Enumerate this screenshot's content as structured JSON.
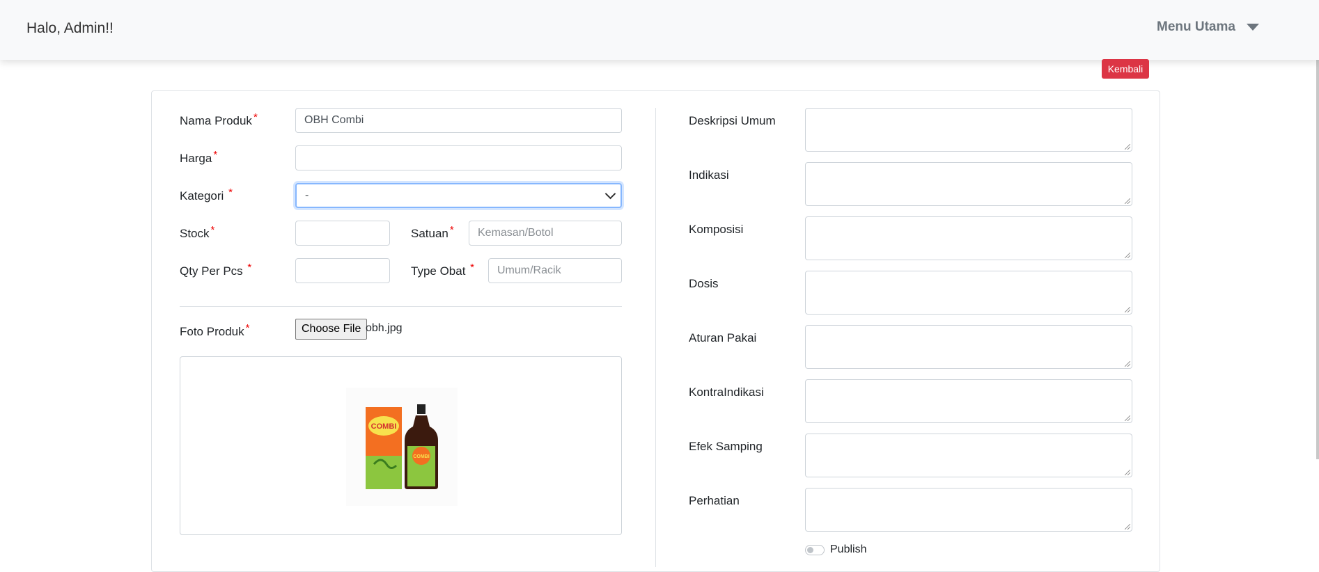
{
  "navbar": {
    "greeting": "Halo, Admin!!",
    "menu_label": "Menu Utama"
  },
  "actions": {
    "back_label": "Kembali"
  },
  "form_left": {
    "nama_produk": {
      "label": "Nama Produk",
      "value": "OBH Combi"
    },
    "harga": {
      "label": "Harga",
      "value": ""
    },
    "kategori": {
      "label": "Kategori",
      "selected": "-"
    },
    "stock": {
      "label": "Stock",
      "value": ""
    },
    "satuan": {
      "label": "Satuan",
      "placeholder": "Kemasan/Botol"
    },
    "qty_per_pcs": {
      "label": "Qty Per Pcs",
      "value": ""
    },
    "type_obat": {
      "label": "Type Obat",
      "placeholder": "Umum/Racik"
    },
    "foto_produk": {
      "label": "Foto Produk",
      "button_label": "Choose File",
      "file_name": "obh.jpg"
    },
    "required_mark": "*"
  },
  "product_image": {
    "box_brand": "COMBI",
    "bottle_brand": "COMBI",
    "colors": {
      "box_orange": "#f36f21",
      "box_green": "#8cc63f",
      "bottle_brown": "#3b1a0e",
      "label_yellow": "#f7e14d"
    }
  },
  "form_right": {
    "fields": [
      {
        "label": "Deskripsi Umum"
      },
      {
        "label": "Indikasi"
      },
      {
        "label": "Komposisi"
      },
      {
        "label": "Dosis"
      },
      {
        "label": "Aturan Pakai"
      },
      {
        "label": "KontraIndikasi"
      },
      {
        "label": "Efek Samping"
      },
      {
        "label": "Perhatian"
      }
    ],
    "publish_label": "Publish",
    "publish_on": false
  },
  "colors": {
    "danger": "#dc3545",
    "focus": "#86b7fe",
    "navbar_bg": "#f8f9fa"
  }
}
